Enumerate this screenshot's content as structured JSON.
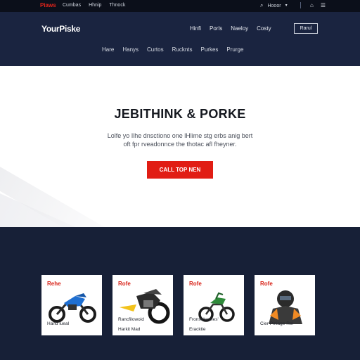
{
  "utility": {
    "brand": "Piaws",
    "links": [
      "Cumbas",
      "Hhnip",
      "Thnock"
    ],
    "search_label": "Hooor",
    "search_icon": "search-icon",
    "dropdown_icon": "chevron-down-icon"
  },
  "header": {
    "logo": "YourPiske",
    "nav": [
      "Hinfi",
      "Porls",
      "Naeloy",
      "Costy"
    ],
    "cta": "Rarul",
    "subnav": [
      "Hare",
      "Hanys",
      "Curtos",
      "Rucknts",
      "Purkes",
      "Prurge"
    ]
  },
  "hero": {
    "title": "JEBITHINK & PORKE",
    "body_line1": "Lolfe yo Ilhe dnsctiono one lHlime stg erbs anig bert",
    "body_line2": "oft fpr rveadonnce the thotac afl fheyner.",
    "cta": "CALL TOP NEN"
  },
  "products": [
    {
      "tag": "Rehe",
      "caption1": "Hand lueal",
      "caption2": "",
      "accent": "#1f6fd1"
    },
    {
      "tag": "Rofe",
      "caption1": "Rancfilowoid",
      "caption2": "Harkit Mad",
      "accent": "#f2c21b"
    },
    {
      "tag": "Rofe",
      "caption1": "Fronsehowies'",
      "caption2": "Eracktie",
      "accent": "#2f8a3a"
    },
    {
      "tag": "Rofe",
      "caption1": "Cier Piniage Rel",
      "caption2": "",
      "accent": "#f08a24"
    }
  ]
}
